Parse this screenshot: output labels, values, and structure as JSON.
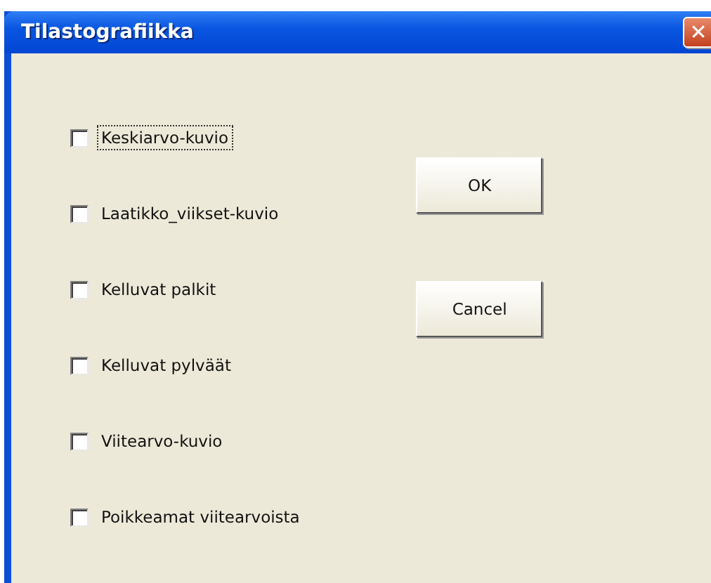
{
  "window": {
    "title": "Tilastografiikka",
    "close_glyph": "✕"
  },
  "options": [
    {
      "label": "Keskiarvo-kuvio",
      "checked": false,
      "focused": true
    },
    {
      "label": "Laatikko_viikset-kuvio",
      "checked": false,
      "focused": false
    },
    {
      "label": "Kelluvat palkit",
      "checked": false,
      "focused": false
    },
    {
      "label": "Kelluvat pylväät",
      "checked": false,
      "focused": false
    },
    {
      "label": "Viitearvo-kuvio",
      "checked": false,
      "focused": false
    },
    {
      "label": "Poikkeamat viitearvoista",
      "checked": false,
      "focused": false
    }
  ],
  "buttons": [
    "OK",
    "Cancel"
  ]
}
